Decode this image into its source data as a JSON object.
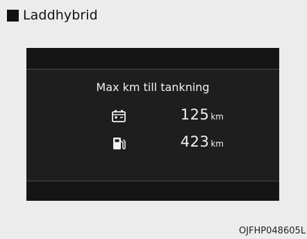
{
  "section": {
    "title": "Laddhybrid"
  },
  "display": {
    "title": "Max km till tankning",
    "rows": [
      {
        "icon": "battery-icon",
        "value": "125",
        "unit": "km"
      },
      {
        "icon": "fuel-pump-icon",
        "value": "423",
        "unit": "km"
      }
    ]
  },
  "figure": {
    "code": "OJFHP048605L"
  }
}
